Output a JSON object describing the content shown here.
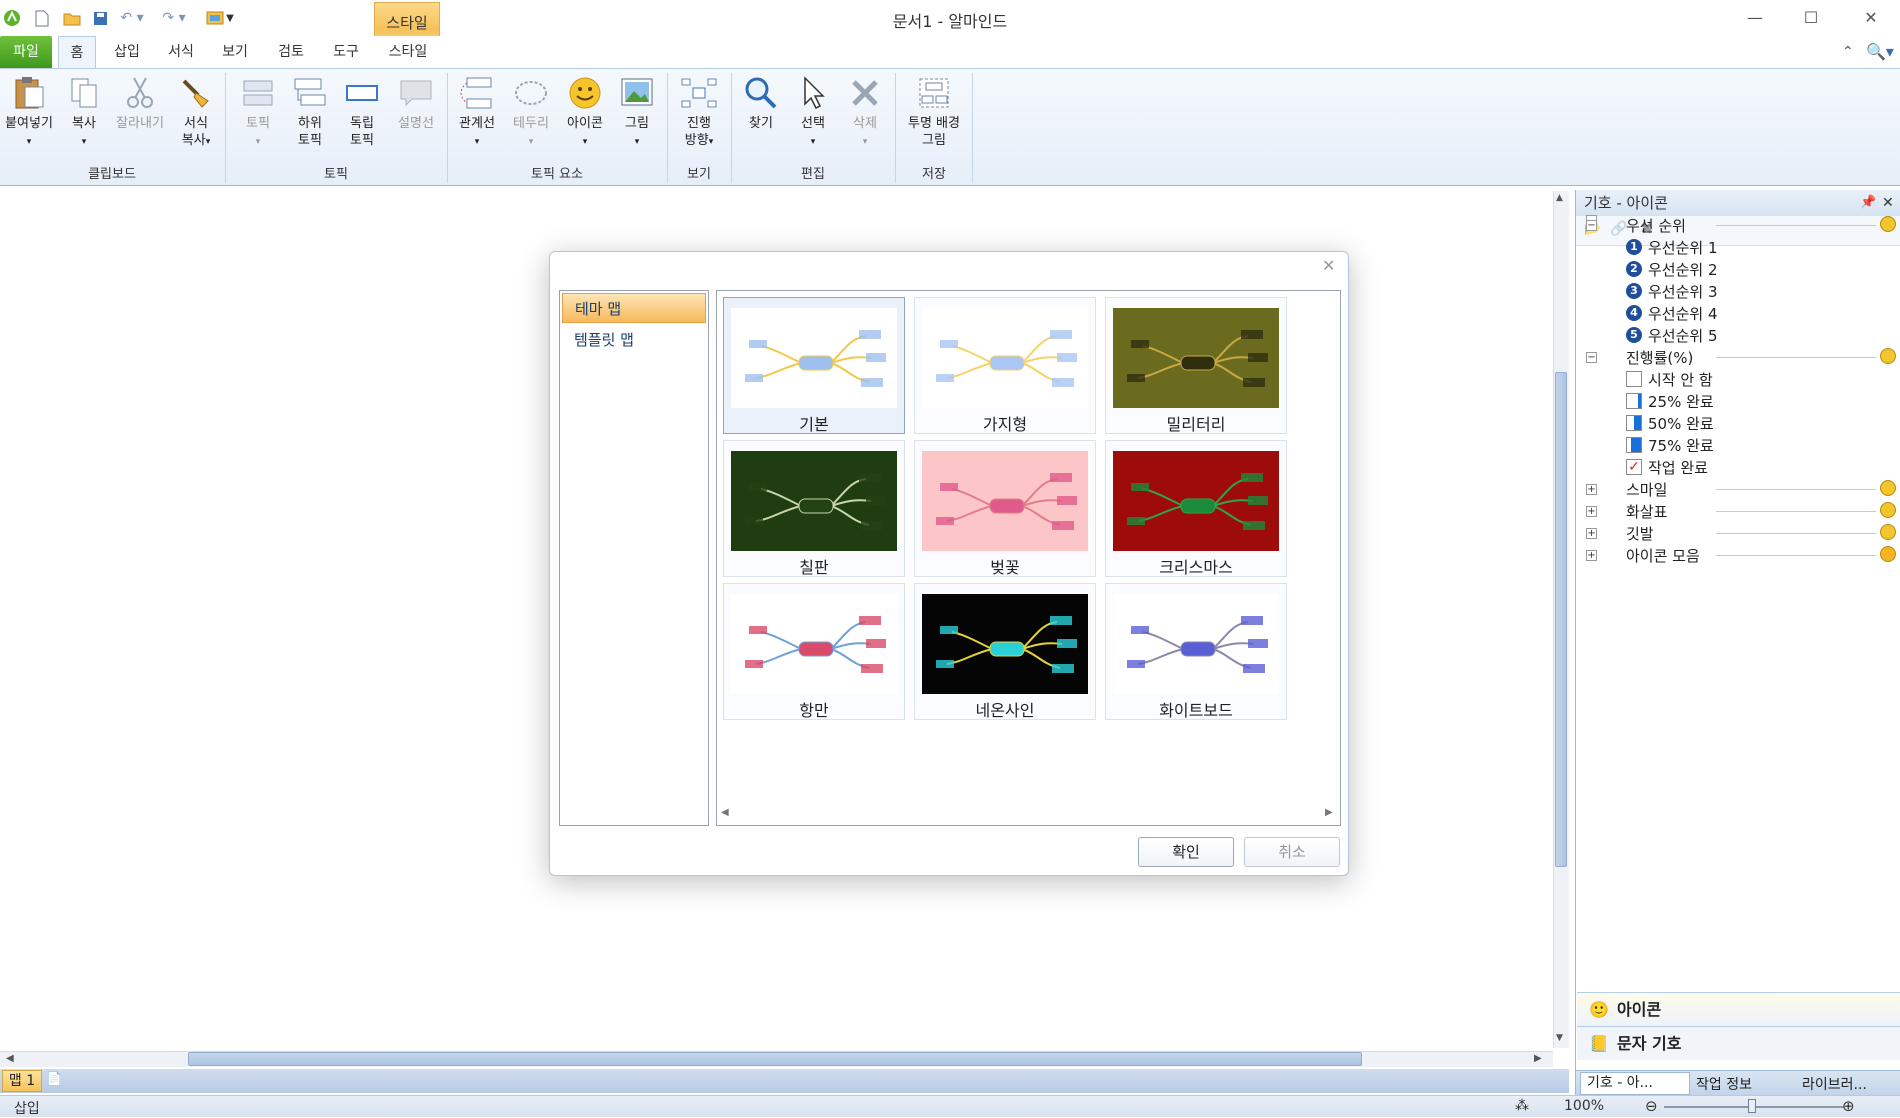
{
  "window": {
    "title": "문서1 - 알마인드"
  },
  "tabs": {
    "file": "파일",
    "home": "홈",
    "insert": "삽입",
    "format": "서식",
    "view": "보기",
    "review": "검토",
    "tools": "도구",
    "style": "스타일",
    "context_group": "스타일"
  },
  "ribbon": {
    "paste": "붙여넣기",
    "copy": "복사",
    "cut": "잘라내기",
    "format_copy_1": "서식",
    "format_copy_2": "복사",
    "topic": "토픽",
    "sub_topic_1": "하위",
    "sub_topic_2": "토픽",
    "float_topic_1": "독립",
    "float_topic_2": "토픽",
    "callout": "설명선",
    "relation": "관계선",
    "boundary": "테두리",
    "icon": "아이콘",
    "image": "그림",
    "direction_1": "진행",
    "direction_2": "방향",
    "find": "찾기",
    "select": "선택",
    "delete": "삭제",
    "transparent_1": "투명 배경",
    "transparent_2": "그림",
    "groups": {
      "clipboard": "클립보드",
      "topic": "토픽",
      "topic_elements": "토픽 요소",
      "view": "보기",
      "edit": "편집",
      "save": "저장"
    }
  },
  "dialog": {
    "left_items": [
      "테마 맵",
      "템플릿 맵"
    ],
    "themes": [
      {
        "name": "기본",
        "bg": "#ffffff",
        "line": "#f2c84b",
        "node": "#9fc0ee"
      },
      {
        "name": "가지형",
        "bg": "#ffffff",
        "line": "#f3d36a",
        "node": "#a9c7f2"
      },
      {
        "name": "밀리터리",
        "bg": "#6b6b1f",
        "line": "#c9a843",
        "node": "#2f2f10"
      },
      {
        "name": "칠판",
        "bg": "#1f3d10",
        "line": "#c9d6a8",
        "node": "#234213"
      },
      {
        "name": "벚꽃",
        "bg": "#fcc6c8",
        "line": "#e37d8c",
        "node": "#e05a8a"
      },
      {
        "name": "크리스마스",
        "bg": "#9e0b0b",
        "line": "#2fa44f",
        "node": "#1b8a3a"
      },
      {
        "name": "항만",
        "bg": "#ffffff",
        "line": "#6fa0d6",
        "node": "#d94b6a"
      },
      {
        "name": "네온사인",
        "bg": "#050505",
        "line": "#e6d23a",
        "node": "#2ad0d8"
      },
      {
        "name": "화이트보드",
        "bg": "#ffffff",
        "line": "#8a8aa8",
        "node": "#5b5fd6"
      }
    ],
    "ok": "확인",
    "cancel": "취소"
  },
  "panel": {
    "title": "기호 - 아이콘",
    "categories": {
      "priority": "우선 순위",
      "progress": "진행률(%)",
      "smile": "스마일",
      "arrow": "화살표",
      "flag": "깃발",
      "collection": "아이콘 모음"
    },
    "priority_items": [
      "우선순위 1",
      "우선순위 2",
      "우선순위 3",
      "우선순위 4",
      "우선순위 5"
    ],
    "progress_items": [
      "시작 안 함",
      "25% 완료",
      "50% 완료",
      "75% 완료",
      "작업 완료"
    ],
    "bottom_buttons": {
      "icons": "아이콘",
      "text_symbols": "문자 기호"
    },
    "bottom_tabs": [
      "기호 - 아...",
      "작업 정보",
      "라이브러..."
    ]
  },
  "maptab": "맵 1",
  "status": {
    "mode": "삽입",
    "zoom": "100%"
  },
  "colors": {
    "accent": "#f7b95a",
    "file_tab": "#3e9a1c",
    "ribbon_bg": "#e6eef8"
  }
}
